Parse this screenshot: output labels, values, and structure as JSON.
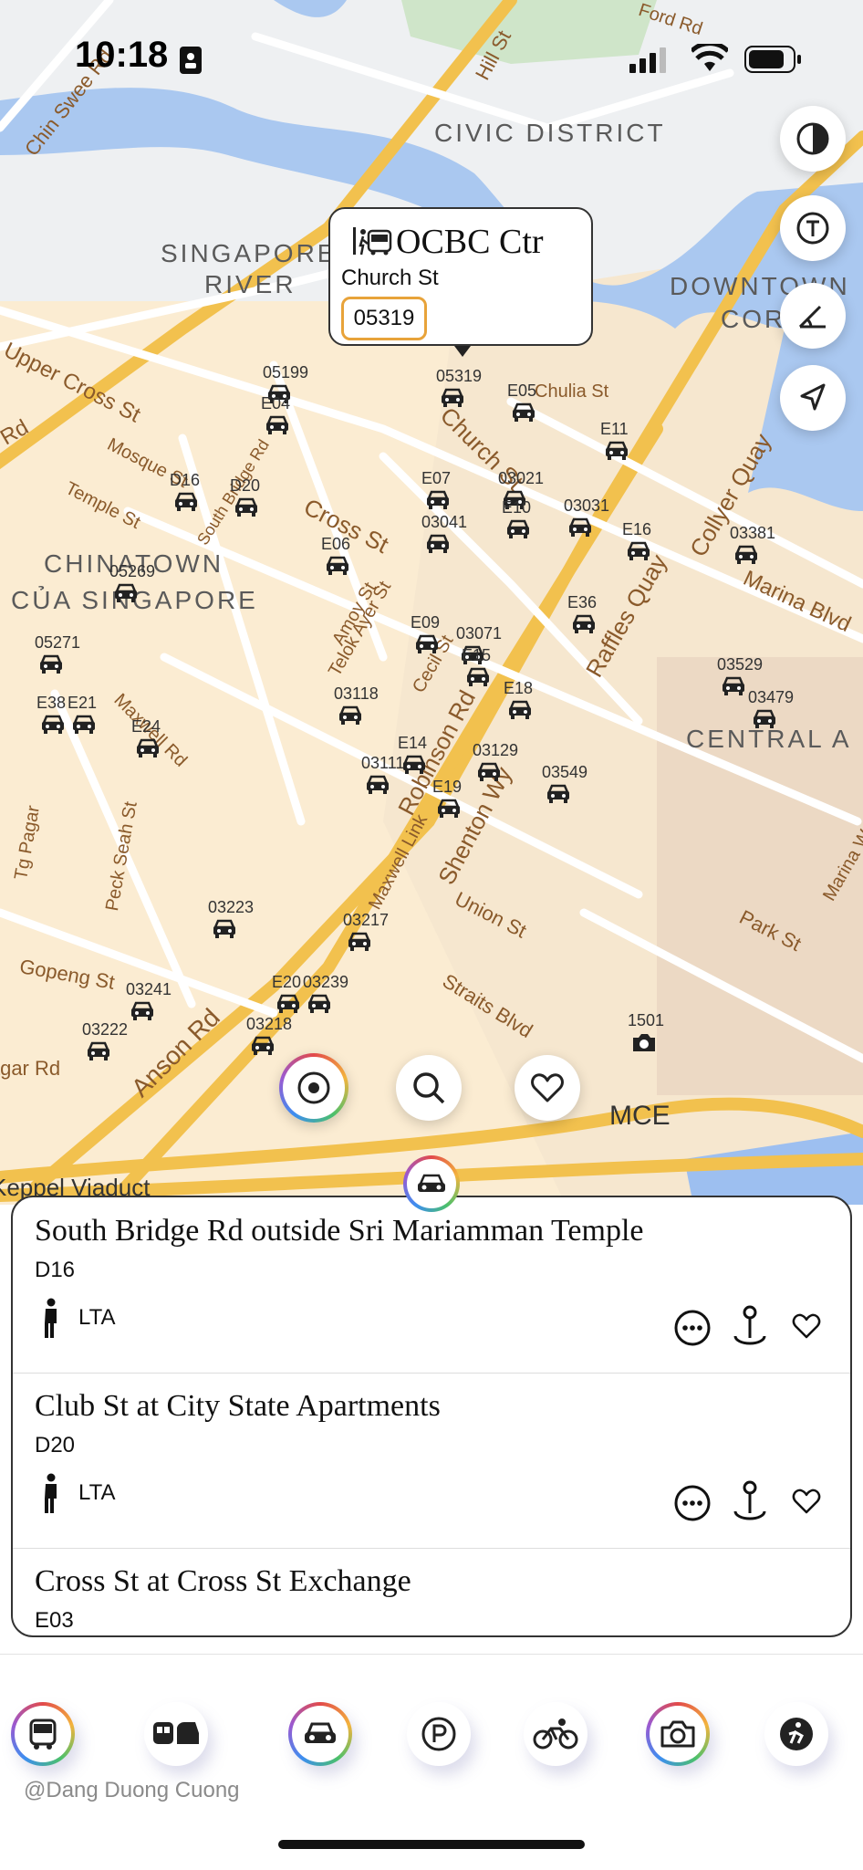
{
  "status_bar": {
    "time": "10:18"
  },
  "map": {
    "districts": [
      "CIVIC DISTRICT",
      "SINGAPORE",
      "RIVER",
      "DOWNTOWN",
      "CORE",
      "CHINATOWN",
      "CỦA SINGAPORE",
      "CENTRAL A"
    ],
    "streets": [
      "Chin Swee Rd",
      "Hill St",
      "Upper Cross St",
      "Mosque St",
      "Temple St",
      "South Bridge Rd",
      "Cross St",
      "Amoy St",
      "Telok Ayer St",
      "Cecil St",
      "Church St",
      "Chulia St",
      "Collyer Quay",
      "Raffles Quay",
      "Marina Blvd",
      "Robinson Rd",
      "Shenton Wy",
      "Maxwell Link",
      "Maxwell Rd",
      "Peck Seah St",
      "Tg Pagar",
      "Union St",
      "Park St",
      "Marina W",
      "Straits Blvd",
      "Gopeng St",
      "Anson Rd",
      "Tanjong Pagar Rd",
      "MCE",
      "Keppel Viaduct",
      "Bridge Rd",
      "Ford Rd"
    ],
    "stop_codes": [
      "05199",
      "E04",
      "05319",
      "E05",
      "E11",
      "D16",
      "D20",
      "E07",
      "03021",
      "03041",
      "E10",
      "03031",
      "E16",
      "03381",
      "E06",
      "05269",
      "E09",
      "03071",
      "E36",
      "03529",
      "05271",
      "E15",
      "E18",
      "03479",
      "E38",
      "E21",
      "E24",
      "03118",
      "E14",
      "03129",
      "03111",
      "E19",
      "03549",
      "03223",
      "03217",
      "03241",
      "E20",
      "03239",
      "03222",
      "03218",
      "1501"
    ],
    "controls": [
      "contrast-icon",
      "tram-icon",
      "angle-icon",
      "location-arrow-icon"
    ]
  },
  "callout": {
    "title": "OCBC Ctr",
    "subtitle": "Church St",
    "code": "05319"
  },
  "floating_actions": [
    "locate-icon",
    "search-icon",
    "heart-icon"
  ],
  "list": [
    {
      "name": "South Bridge Rd outside Sri Mariamman Temple",
      "code": "D16",
      "operator": "LTA"
    },
    {
      "name": "Club St at City State Apartments",
      "code": "D20",
      "operator": "LTA"
    },
    {
      "name": "Cross St at Cross St Exchange",
      "code": "E03",
      "operator": ""
    }
  ],
  "tabs": [
    "bus-icon",
    "train-icon",
    "car-icon",
    "parking-icon",
    "bicycle-icon",
    "camera-icon",
    "taxi-icon"
  ],
  "credit": "@Dang Duong Cuong",
  "colors": {
    "accent_orange": "#e8a33a",
    "map_road": "#f2c14e",
    "water": "#aac8f0"
  }
}
